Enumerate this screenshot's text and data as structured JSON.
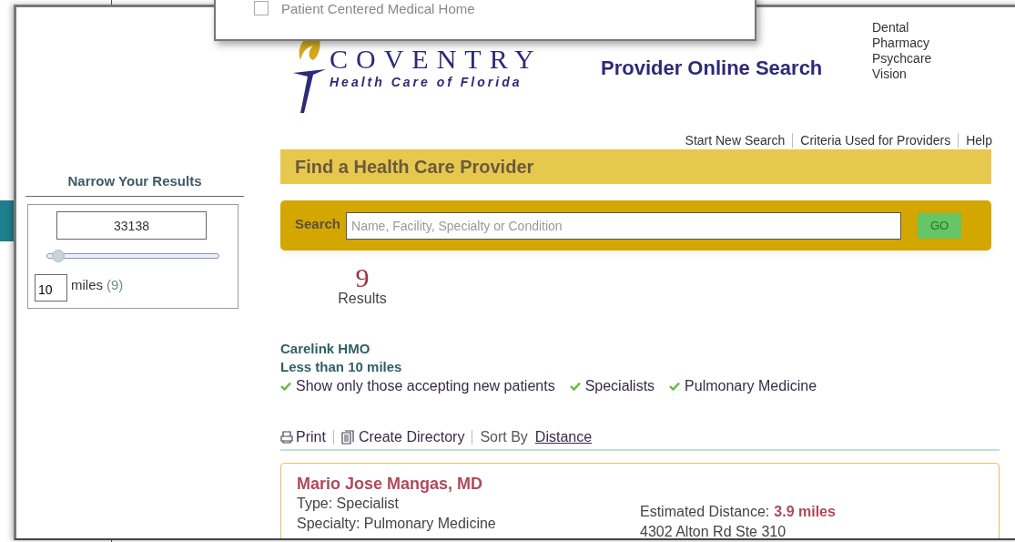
{
  "popup": {
    "options": [
      {
        "label": "Patient Centered Medical Home",
        "checked": false
      }
    ]
  },
  "header": {
    "logo": {
      "name": "COVENTRY",
      "tagline": "Health Care of Florida"
    },
    "title": "Provider Online Search",
    "product_links": [
      "Dental",
      "Pharmacy",
      "Psychcare",
      "Vision"
    ]
  },
  "nav_links": [
    "Start New Search",
    "Criteria Used for Providers",
    "Help"
  ],
  "page_title": "Find a Health Care Provider",
  "search": {
    "label": "Search",
    "placeholder": "Name, Facility, Specialty or Condition",
    "button": "GO"
  },
  "results": {
    "count": "9",
    "label": "Results"
  },
  "sidebar": {
    "title": "Narrow Your Results",
    "zip": "33138",
    "radius": {
      "level": 0.06
    },
    "miles_value": "10",
    "miles_label": "miles",
    "miles_count": "(9)"
  },
  "criteria": {
    "plan": "Carelink HMO",
    "distance": "Less than 10 miles",
    "filters": [
      "Show only those accepting new patients",
      "Specialists",
      "Pulmonary Medicine"
    ]
  },
  "toolbar": {
    "print": "Print",
    "directory": "Create Directory",
    "sort_label": "Sort By",
    "sort_value": "Distance"
  },
  "providers": [
    {
      "name": "Mario Jose Mangas, MD",
      "type": "Type: Specialist",
      "specialty": "Specialty: Pulmonary Medicine",
      "distance_label": "Estimated Distance:",
      "distance": "3.9 miles",
      "address": "4302 Alton Rd Ste 310"
    }
  ]
}
